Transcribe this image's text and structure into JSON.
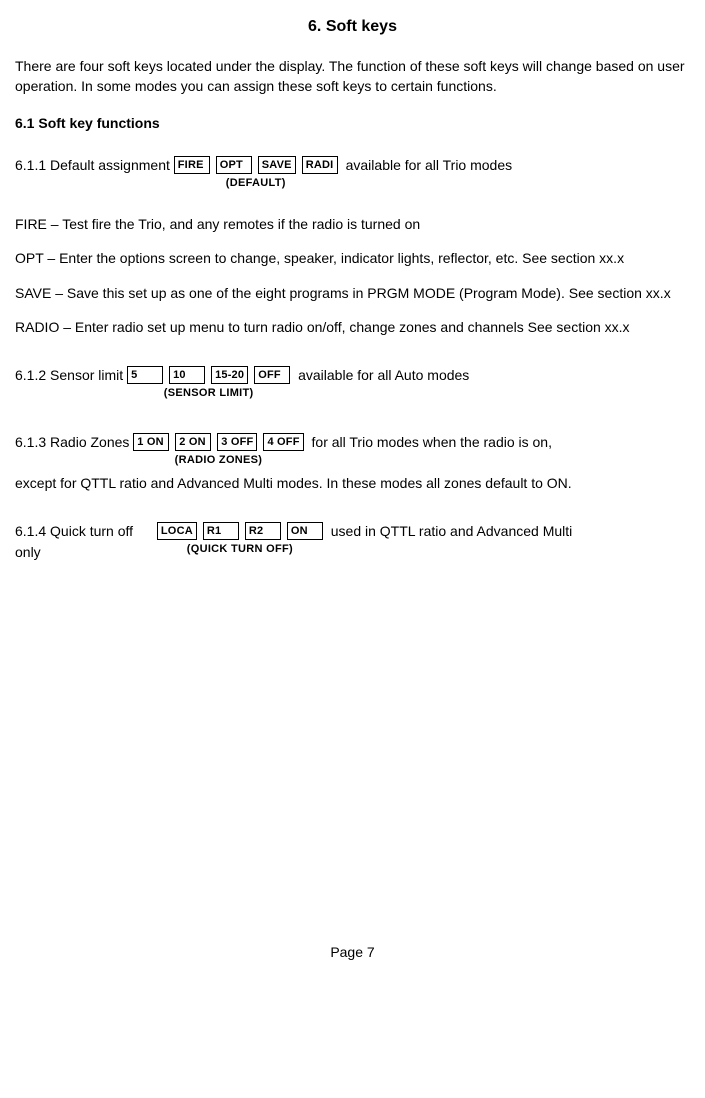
{
  "title": "6.   Soft keys",
  "intro": "There are four soft keys located under the display.  The function of these soft keys will change based on user operation. In some modes you can assign these soft keys to certain functions.",
  "sec61": "6.1 Soft key functions",
  "s611": {
    "lead": "6.1.1 Default assignment",
    "keys": [
      "FIRE",
      "OPT",
      "SAVE",
      "RADI"
    ],
    "cap": "(DEFAULT)",
    "trail": " available for all Trio modes"
  },
  "desc": {
    "fire": "FIRE – Test fire the Trio, and any remotes if the radio is turned on",
    "opt": "OPT – Enter the options screen to change, speaker, indicator lights, reflector, etc.  See section xx.x",
    "save": "SAVE – Save this set up as one of the eight programs in PRGM MODE (Program Mode). See section xx.x",
    "radio": "RADIO – Enter radio set up menu to turn radio on/off, change zones  and channels  See section xx.x"
  },
  "s612": {
    "lead": "6.1.2 Sensor limit ",
    "keys": [
      "5",
      "10",
      "15-20",
      "OFF"
    ],
    "cap": "(SENSOR LIMIT)",
    "trail": "  available for all Auto modes"
  },
  "s613": {
    "lead": "6.1.3 Radio Zones  ",
    "keys": [
      "1 ON",
      "2 ON",
      "3 OFF",
      "4 OFF"
    ],
    "cap": "(RADIO ZONES)",
    "trail": "  for all Trio modes when the radio is on,",
    "cont": "except for QTTL ratio and Advanced Multi modes.  In these modes all zones default to ON."
  },
  "s614": {
    "lead": "6.1.4 Quick turn off ",
    "lead2": "only",
    "keys": [
      "LOCA",
      "R1",
      "R2",
      "ON"
    ],
    "cap": "(QUICK TURN OFF)",
    "trail": "  used in QTTL ratio and Advanced Multi"
  },
  "pagefoot": "Page 7"
}
